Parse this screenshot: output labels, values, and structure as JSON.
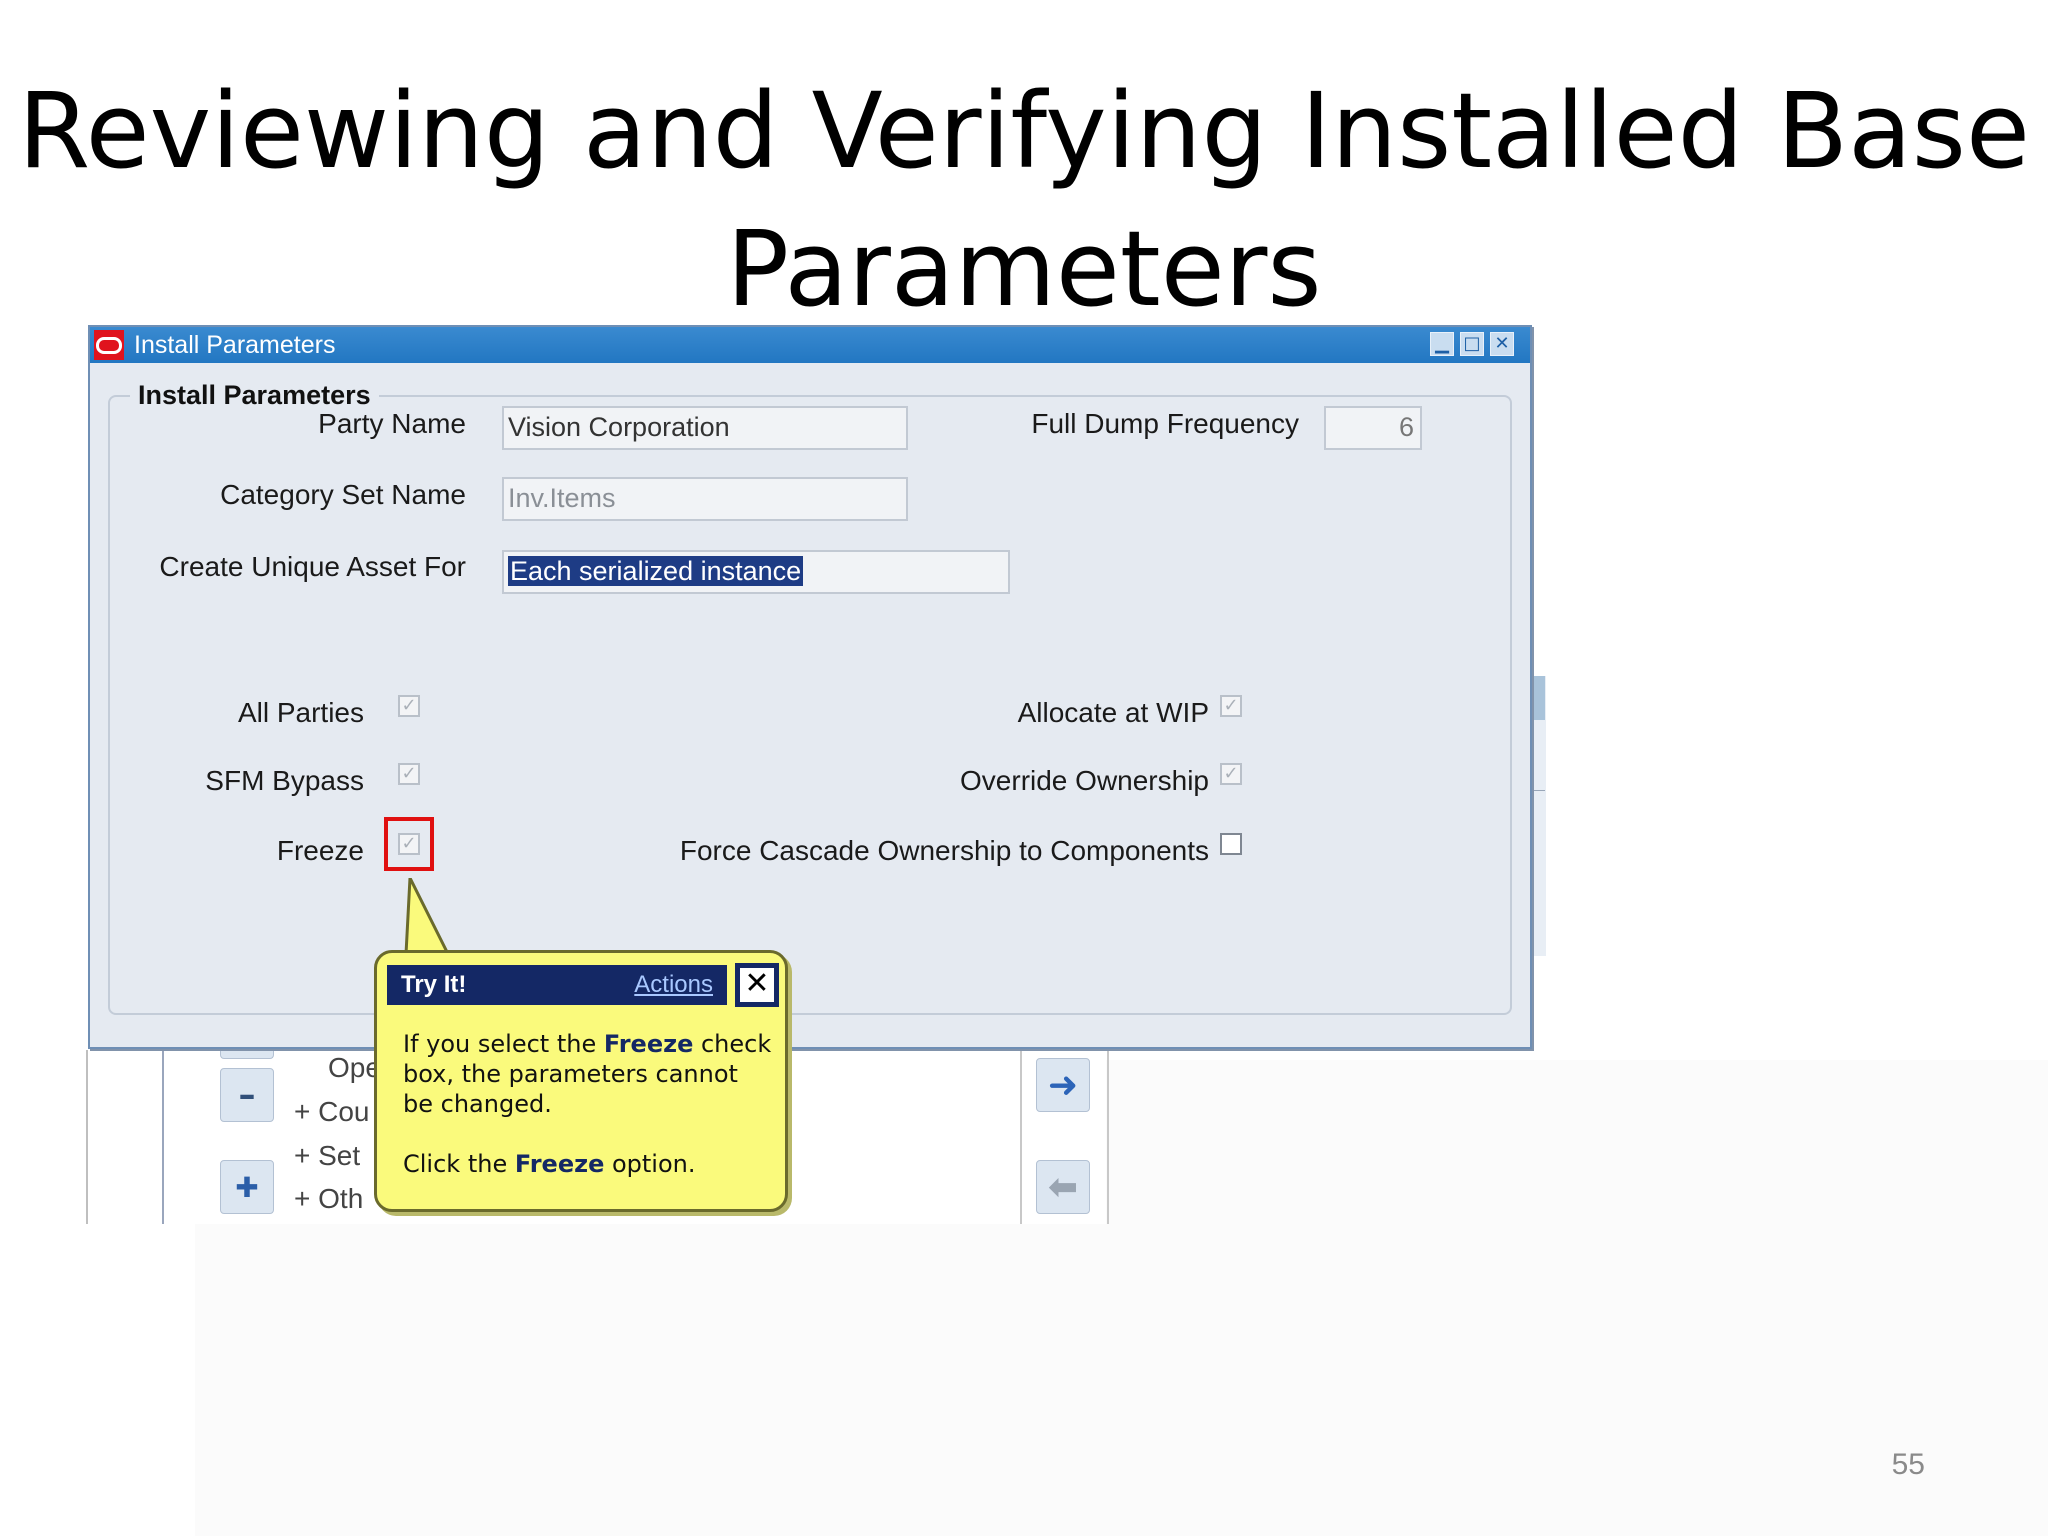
{
  "slide": {
    "title_line1": "Reviewing and Verifying Installed Base",
    "title_line2": "Parameters",
    "page_number": "55"
  },
  "window": {
    "title": "Install Parameters",
    "icons": [
      "oracle-logo-icon",
      "minimize-icon",
      "maximize-icon",
      "close-icon"
    ]
  },
  "group": {
    "label": "Install Parameters"
  },
  "fields": {
    "party_name_label": "Party Name",
    "party_name_value": "Vision Corporation",
    "category_set_label": "Category Set Name",
    "category_set_value": "Inv.Items",
    "create_unique_label": "Create Unique Asset For",
    "create_unique_value": "Each serialized instance",
    "full_dump_label": "Full Dump Frequency",
    "full_dump_value": "6"
  },
  "checkboxes": {
    "all_parties": {
      "label": "All Parties",
      "checked": true
    },
    "sfm_bypass": {
      "label": "SFM Bypass",
      "checked": true
    },
    "freeze": {
      "label": "Freeze",
      "checked": true
    },
    "allocate_wip": {
      "label": "Allocate at WIP",
      "checked": true
    },
    "override_ownership": {
      "label": "Override Ownership",
      "checked": true
    },
    "force_cascade": {
      "label": "Force Cascade Ownership to Components",
      "checked": false
    }
  },
  "tryit": {
    "heading": "Try It!",
    "actions_link": "Actions",
    "close_symbol": "✕",
    "text1_pre": "If you select the ",
    "text1_bold": "Freeze",
    "text1_post": " check box, the parameters cannot be changed.",
    "text2_pre": "Click the ",
    "text2_bold": "Freeze",
    "text2_post": " option."
  },
  "background": {
    "tree_items": [
      "Ope",
      "+  Cou",
      "+  Set",
      "+  Oth"
    ]
  },
  "colors": {
    "titlebar": "#2277c2",
    "highlight": "#e01010",
    "bubble": "#fafa7c",
    "bubble_header": "#142865",
    "selection": "#1e3c85"
  }
}
